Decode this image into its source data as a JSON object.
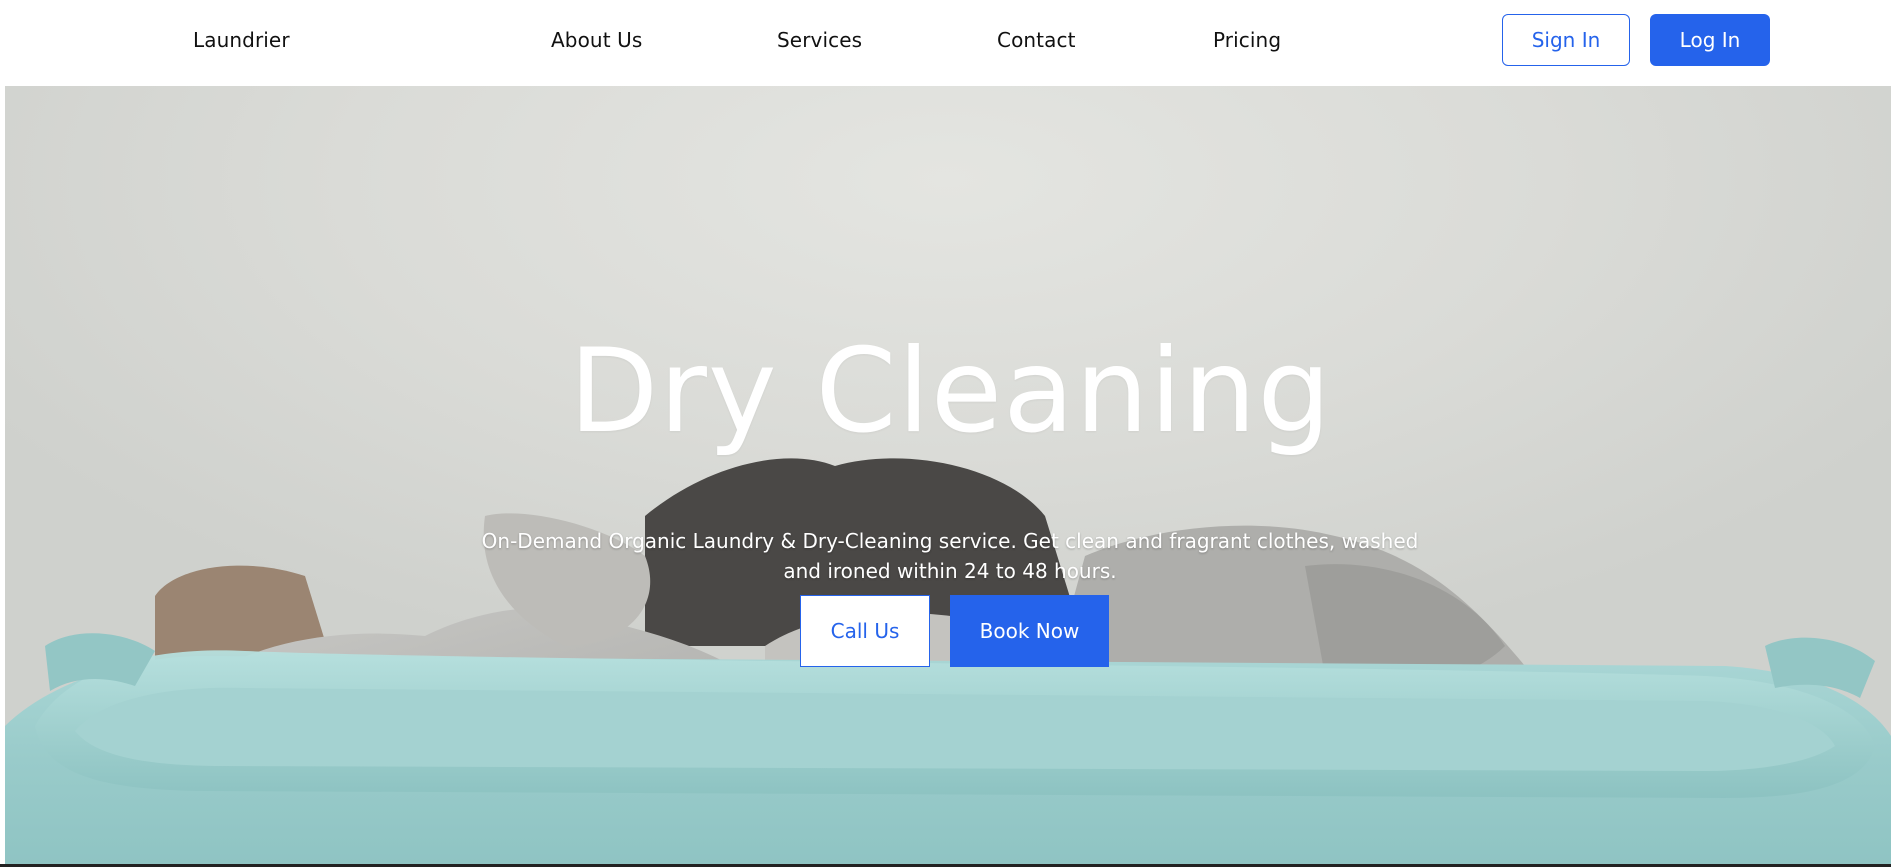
{
  "nav": {
    "brand": "Laundrier",
    "links": [
      "About Us",
      "Services",
      "Contact",
      "Pricing"
    ],
    "sign_in": "Sign In",
    "log_in": "Log In"
  },
  "hero": {
    "title": "Dry Cleaning",
    "subtitle_line1": "On-Demand Organic Laundry & Dry-Cleaning service. Get clean and fragrant clothes, washed",
    "subtitle_line2": "and ironed within 24 to 48 hours.",
    "call_us": "Call Us",
    "book_now": "Book Now",
    "image": "laundry-basket-with-clothes"
  },
  "colors": {
    "accent": "#2563eb",
    "basket": "#9fcfcf",
    "wall": "#dcddd9"
  }
}
